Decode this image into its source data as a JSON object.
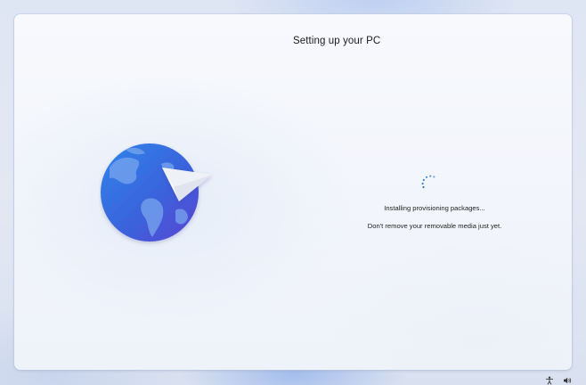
{
  "setup": {
    "title": "Setting up your PC",
    "status_line_1": "Installing provisioning packages...",
    "status_line_2": "Don't remove your removable media just yet."
  },
  "illustration": {
    "icon": "globe-with-paper-plane",
    "globe_colors": [
      "#2f7ae6",
      "#5b49d6"
    ],
    "land_color": "#6c9de8",
    "plane_color": "#ffffff"
  },
  "spinner": {
    "icon": "loading-dots",
    "color": "#1f6fcf"
  },
  "taskbar": {
    "icons": [
      "accessibility-icon",
      "volume-icon"
    ]
  }
}
